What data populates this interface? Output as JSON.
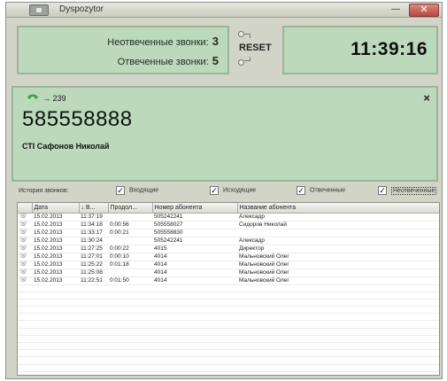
{
  "window": {
    "title": "Dyspozytor",
    "minimize_label": "—",
    "close_label": "✕"
  },
  "counters": {
    "missed_label": "Неотвеченные звонки:",
    "missed_count": "3",
    "answered_label": "Отвеченные звонки:",
    "answered_count": "5",
    "reset_label": "RESET"
  },
  "clock": {
    "time": "11:39:16"
  },
  "call": {
    "route": "→ 239",
    "number": "585558888",
    "caller_name": "СТІ Сафонов Николай",
    "dismiss_label": "×"
  },
  "history": {
    "label": "История звонков:",
    "filters": [
      {
        "label": "Входящие",
        "checked": true
      },
      {
        "label": "Исходящие",
        "checked": true
      },
      {
        "label": "Отвеченные",
        "checked": true
      },
      {
        "label": "Неотвеченные",
        "checked": true
      }
    ],
    "columns": [
      "",
      "Дата",
      "↓ В...",
      "Продол...",
      "Номер абонента",
      "Название абонента"
    ],
    "rows": [
      {
        "icon": "☏",
        "date": "15.02.2013",
        "time": "11:37:19",
        "duration": "",
        "number": "505242241",
        "name": "Алексадр"
      },
      {
        "icon": "☏",
        "date": "15.02.2013",
        "time": "11:34:18",
        "duration": "0:00:56",
        "number": "505558027",
        "name": "Сидоров Николай"
      },
      {
        "icon": "☏",
        "date": "15.02.2013",
        "time": "11:33:17",
        "duration": "0:00:21",
        "number": "505558830",
        "name": ""
      },
      {
        "icon": "☏",
        "date": "15.02.2013",
        "time": "11:30:24",
        "duration": "",
        "number": "505242241",
        "name": "Алексадр"
      },
      {
        "icon": "☏",
        "date": "15.02.2013",
        "time": "11:27:25",
        "duration": "0:00:22",
        "number": "4015",
        "name": "Директор"
      },
      {
        "icon": "☏",
        "date": "15.02.2013",
        "time": "11:27:01",
        "duration": "0:00:10",
        "number": "4014",
        "name": "Мальновский Олег"
      },
      {
        "icon": "☏",
        "date": "15.02.2013",
        "time": "11:25:22",
        "duration": "0:01:18",
        "number": "4014",
        "name": "Мальновский Олег"
      },
      {
        "icon": "☏",
        "date": "15.02.2013",
        "time": "11:25:08",
        "duration": "",
        "number": "4014",
        "name": "Мальновский Олег"
      },
      {
        "icon": "☏",
        "date": "15.02.2013",
        "time": "11:22:51",
        "duration": "0:01:50",
        "number": "4014",
        "name": "Мальновский Олег"
      }
    ]
  },
  "colors": {
    "panel_green": "#bcd9bb",
    "window_bg": "#d2d4c8",
    "close_red": "#b5473f",
    "phone_green": "#3aa04a"
  }
}
